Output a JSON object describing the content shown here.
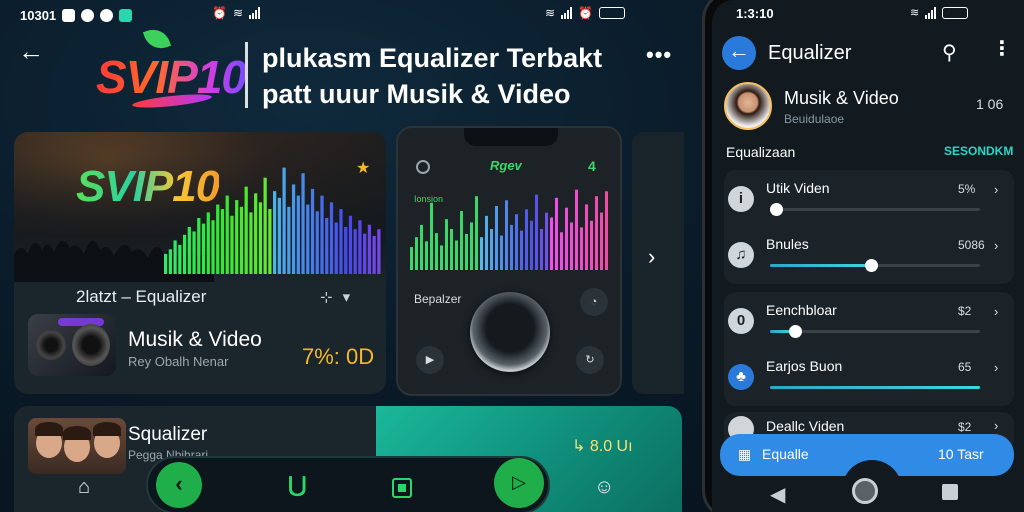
{
  "left_status": {
    "time": "10301",
    "right_batt": ""
  },
  "header": {
    "logo_text": "SVIP10",
    "title_line1": "plukasm Equalizer Terbakt",
    "title_line2": "patt uuur Musik & Video"
  },
  "main_card": {
    "banner_text": "SVIP10",
    "label": "2latzt  – Equalizer",
    "media_title": "Musik & Video",
    "media_subtitle": "Rey Obalh Nenar",
    "percent": "7%: 0D",
    "eq_levels": [
      0.18,
      0.22,
      0.3,
      0.26,
      0.35,
      0.42,
      0.38,
      0.5,
      0.45,
      0.55,
      0.48,
      0.62,
      0.58,
      0.7,
      0.52,
      0.66,
      0.6,
      0.78,
      0.55,
      0.72,
      0.64,
      0.86,
      0.58,
      0.74,
      0.68,
      0.95,
      0.6,
      0.8,
      0.7,
      0.9,
      0.62,
      0.76,
      0.56,
      0.7,
      0.5,
      0.64,
      0.46,
      0.58,
      0.42,
      0.52,
      0.4,
      0.48,
      0.36,
      0.44,
      0.34,
      0.4
    ]
  },
  "phone_card": {
    "title": "Rgev",
    "side_label": "4",
    "eq_caption": "Ionsion",
    "label": "Bepalzer",
    "eq_levels": [
      0.28,
      0.4,
      0.55,
      0.35,
      0.82,
      0.45,
      0.3,
      0.62,
      0.5,
      0.36,
      0.72,
      0.44,
      0.58,
      0.9,
      0.4,
      0.66,
      0.5,
      0.78,
      0.42,
      0.85,
      0.55,
      0.68,
      0.48,
      0.74,
      0.6,
      0.92,
      0.5,
      0.7,
      0.64,
      0.88,
      0.46,
      0.76,
      0.58,
      0.98,
      0.52,
      0.8,
      0.6,
      0.9,
      0.7,
      0.96
    ]
  },
  "bottom_card": {
    "title": "Squalizer",
    "subtitle": "Pegga Nbihrari",
    "value": "↳ 8.0 Uı"
  },
  "right_phone": {
    "status_time": "1:3:10",
    "header_title": "Equalizer",
    "media_title": "Musik & Video",
    "media_subtitle": "Beuidulaoe",
    "media_num": "1 06",
    "section_label": "Equalizaan",
    "section_tag": "SESONDKM",
    "rows": [
      {
        "icon": "i",
        "label": "Utik Viden",
        "value": "5%",
        "level": 0.03
      },
      {
        "icon": "♫",
        "label": "Bnules",
        "value": "5086",
        "level": 0.48
      },
      {
        "icon": "0",
        "label": "Eenchbloar",
        "value": "$2",
        "level": 0.12
      },
      {
        "icon": "♣",
        "label": "Earjos Buon",
        "value": "65",
        "level": 1.0
      }
    ],
    "partial_row_label": "Deallc Viden",
    "partial_row_value": "$2",
    "blue_label": "Equalle",
    "blue_value": "10 Tasr"
  },
  "colors": {
    "accent_green": "#1fae4a",
    "accent_teal": "#1ab89a",
    "accent_blue": "#2f8be6",
    "accent_gold": "#f5b82a"
  }
}
